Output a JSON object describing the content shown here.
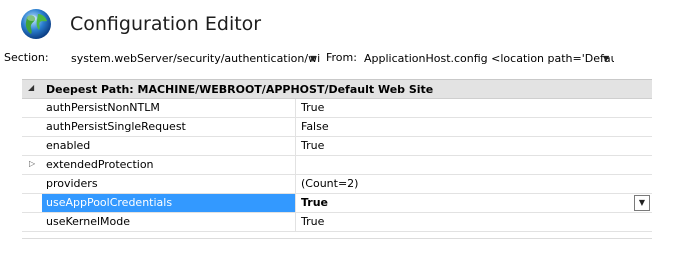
{
  "header": {
    "title": "Configuration Editor",
    "icon": "globe-icon"
  },
  "toolbar": {
    "section_label": "Section:",
    "section_value": "system.webServer/security/authentication/windowsAuthentication",
    "from_label": "From:",
    "from_value": "ApplicationHost.config <location path='Default Web Site' />"
  },
  "grid": {
    "group_header": "Deepest Path: MACHINE/WEBROOT/APPHOST/Default Web Site",
    "rows": [
      {
        "name": "authPersistNonNTLM",
        "value": "True"
      },
      {
        "name": "authPersistSingleRequest",
        "value": "False"
      },
      {
        "name": "enabled",
        "value": "True"
      },
      {
        "name": "extendedProtection",
        "value": ""
      },
      {
        "name": "providers",
        "value": "(Count=2)"
      },
      {
        "name": "useAppPoolCredentials",
        "value": "True"
      },
      {
        "name": "useKernelMode",
        "value": "True"
      }
    ]
  },
  "colors": {
    "selection": "#3399ff",
    "group_header_bg": "#e3e3e3"
  }
}
